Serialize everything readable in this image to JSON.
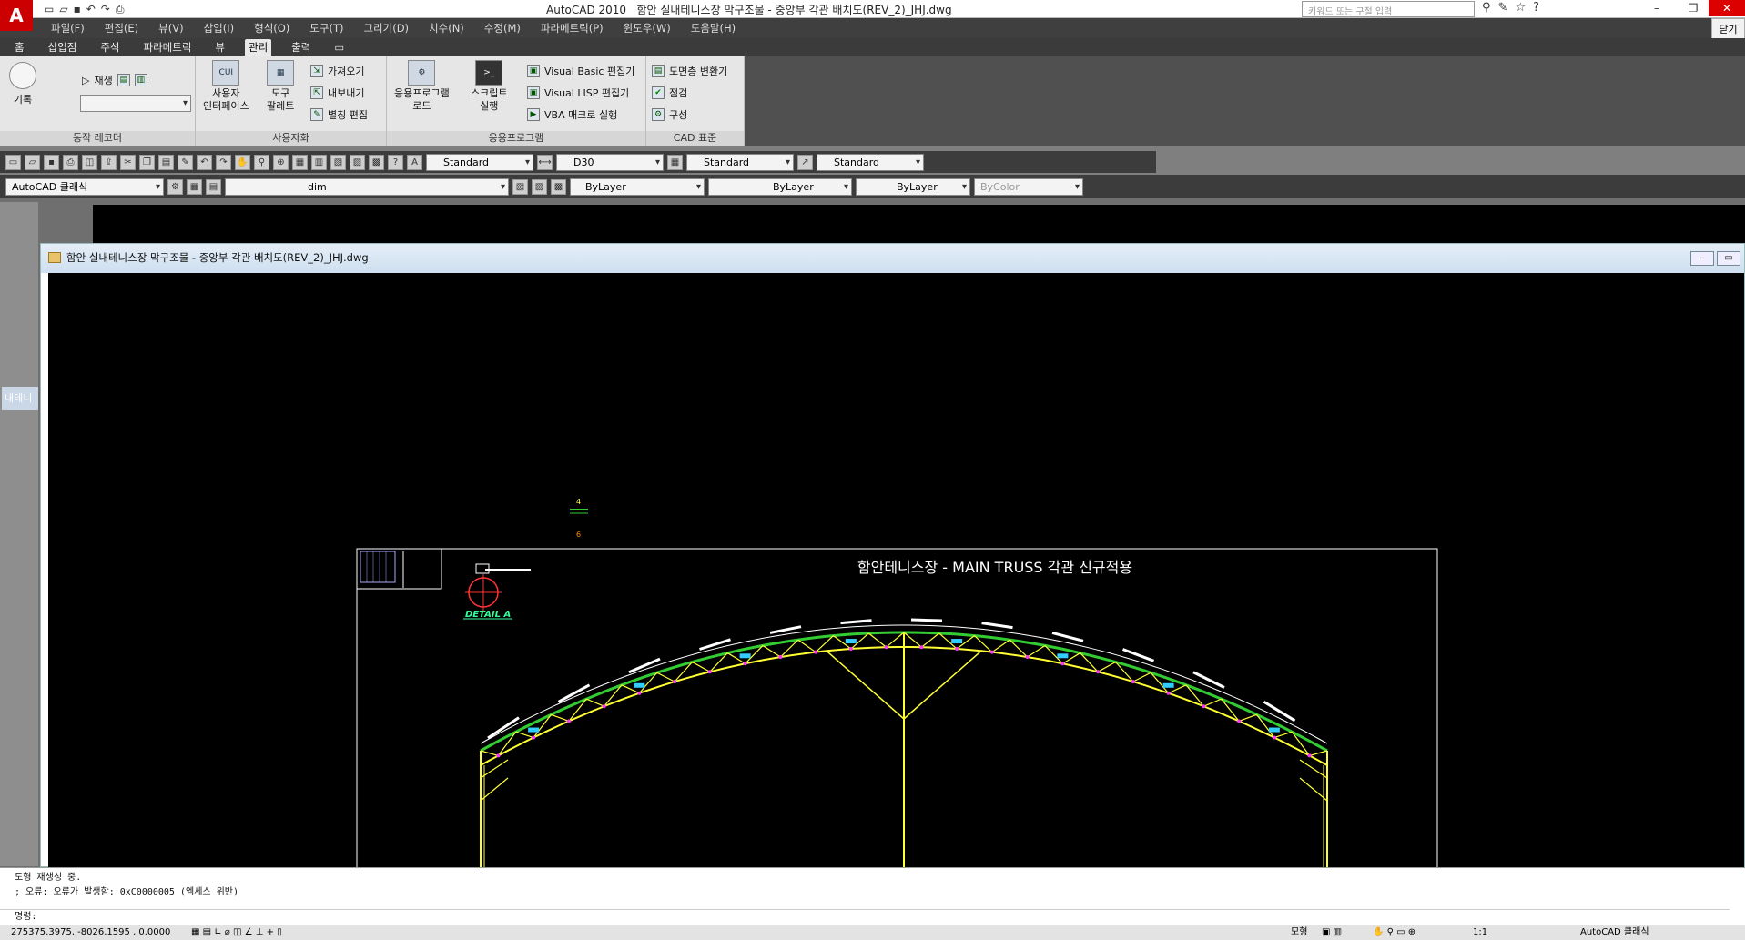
{
  "title_bar": {
    "app_name": "AutoCAD 2010",
    "document": "함안 실내테니스장 막구조물 - 중앙부 각관 배치도(REV_2)_JHJ.dwg",
    "search_placeholder": "키워드 또는 구절 입력",
    "close_side_label": "닫기"
  },
  "menu": [
    "파일(F)",
    "편집(E)",
    "뷰(V)",
    "삽입(I)",
    "형식(O)",
    "도구(T)",
    "그리기(D)",
    "치수(N)",
    "수정(M)",
    "파라메트릭(P)",
    "윈도우(W)",
    "도움말(H)"
  ],
  "ribbon_tabs": [
    "홈",
    "삽입점",
    "주석",
    "파라메트릭",
    "뷰",
    "관리",
    "출력"
  ],
  "active_tab": "관리",
  "ribbon": {
    "action_recorder": {
      "title": "동작 레코더",
      "record": "기록",
      "play": "재생"
    },
    "customization": {
      "title": "사용자화",
      "cui": "사용자\n인터페이스",
      "cui_icon": "CUI",
      "palette": "도구\n팔레트",
      "import": "가져오기",
      "export": "내보내기",
      "alias": "별칭 편집"
    },
    "applications": {
      "title": "응용프로그램",
      "load": "응용프로그램\n로드",
      "script": "스크립트\n실행",
      "vba_editor": "Visual Basic 편집기",
      "lisp_editor": "Visual LISP 편집기",
      "vba_run": "VBA 매크로 실행"
    },
    "cad_standards": {
      "title": "CAD 표준",
      "layer_translator": "도면층 변환기",
      "check": "점검",
      "configure": "구성"
    }
  },
  "toolbar1": {
    "text_style": "Standard",
    "dim_style": "D30",
    "table_style": "Standard",
    "mleader_style": "Standard"
  },
  "toolbar2": {
    "workspace": "AutoCAD 클래식",
    "layer": "dim",
    "color": "ByLayer",
    "linetype": "ByLayer",
    "lineweight": "ByLayer",
    "plotstyle": "ByColor"
  },
  "left_tab_label": "내테니",
  "drawing_window": {
    "title": "함안 실내테니스장 막구조물 - 중앙부 각관 배치도(REV_2)_JHJ.dwg"
  },
  "drawing": {
    "heading": "함안테니스장 - MAIN TRUSS 각관 신규적용",
    "detail_label": "DETAIL A",
    "colors": {
      "truss": "#ffff33",
      "chord": "#33cc33",
      "frame": "#ffffff",
      "node": "#ff33ff",
      "label": "#33ff99"
    }
  },
  "command_line": {
    "line1": "도형 재생성 중.",
    "line2": "; 오류: 오류가 발생함: 0xC0000005 (엑세스 위반)",
    "prompt": "명령:"
  },
  "status_bar": {
    "coords": "275375.3975, -8026.1595 , 0.0000",
    "model": "모형",
    "scale": "1:1",
    "workspace": "AutoCAD 클래식"
  }
}
